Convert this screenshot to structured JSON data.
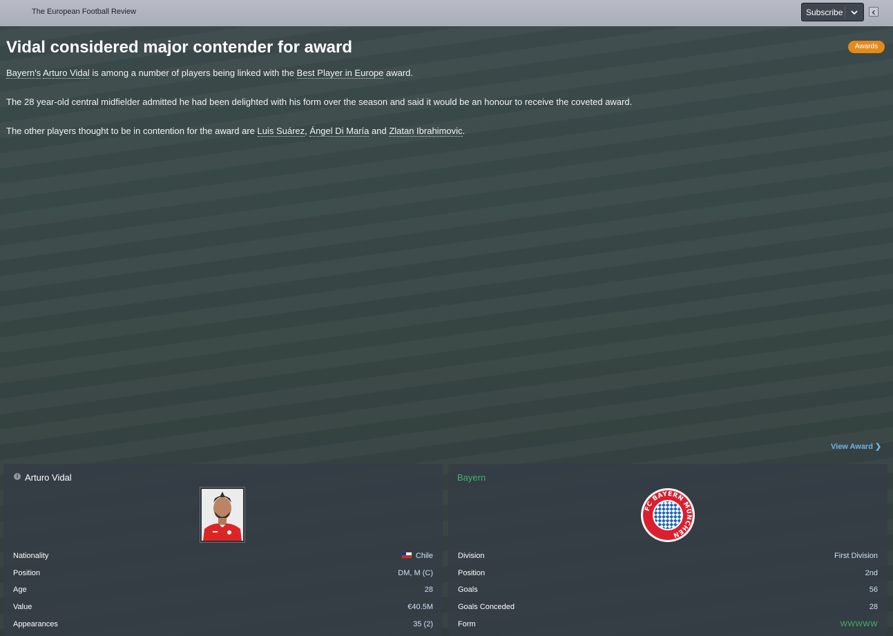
{
  "header": {
    "paper_name": "The European Football Review",
    "subscribe_label": "Subscribe"
  },
  "article": {
    "headline": "Vidal considered major contender for award",
    "tag": "Awards",
    "p1": {
      "club_link": "Bayern's",
      "player_link": "Arturo Vidal",
      "text_mid": " is among a number of players being linked with the ",
      "award_link": "Best Player in Europe",
      "text_end": " award."
    },
    "p2": "The 28 year-old central midfielder admitted he had been delighted with his form over the season and said it would be an honour to receive the coveted award.",
    "p3": {
      "text_start": "The other players thought to be in contention for the award are ",
      "player1": "Luis Suárez",
      "sep1": ", ",
      "player2": "Ángel Di María",
      "sep2": " and ",
      "player3": "Zlatan Ibrahimovic",
      "text_end": "."
    },
    "view_award_label": "View Award"
  },
  "player_card": {
    "name": "Arturo Vidal",
    "rows": [
      {
        "label": "Nationality",
        "value": "Chile"
      },
      {
        "label": "Position",
        "value": "DM, M (C)"
      },
      {
        "label": "Age",
        "value": "28"
      },
      {
        "label": "Value",
        "value": "€40.5M"
      },
      {
        "label": "Appearances",
        "value": "35 (2)"
      }
    ]
  },
  "club_card": {
    "name": "Bayern",
    "crest_text": "FC BAYERN MÜNCHEN",
    "rows": [
      {
        "label": "Division",
        "value": "First Division"
      },
      {
        "label": "Position",
        "value": "2nd"
      },
      {
        "label": "Goals",
        "value": "56"
      },
      {
        "label": "Goals Conceded",
        "value": "28"
      },
      {
        "label": "Form",
        "value": "WWWWW"
      }
    ]
  },
  "colors": {
    "accent_tag": "#e38a1a",
    "link_blue": "#6fb3e8",
    "club_green": "#3fb56a"
  }
}
